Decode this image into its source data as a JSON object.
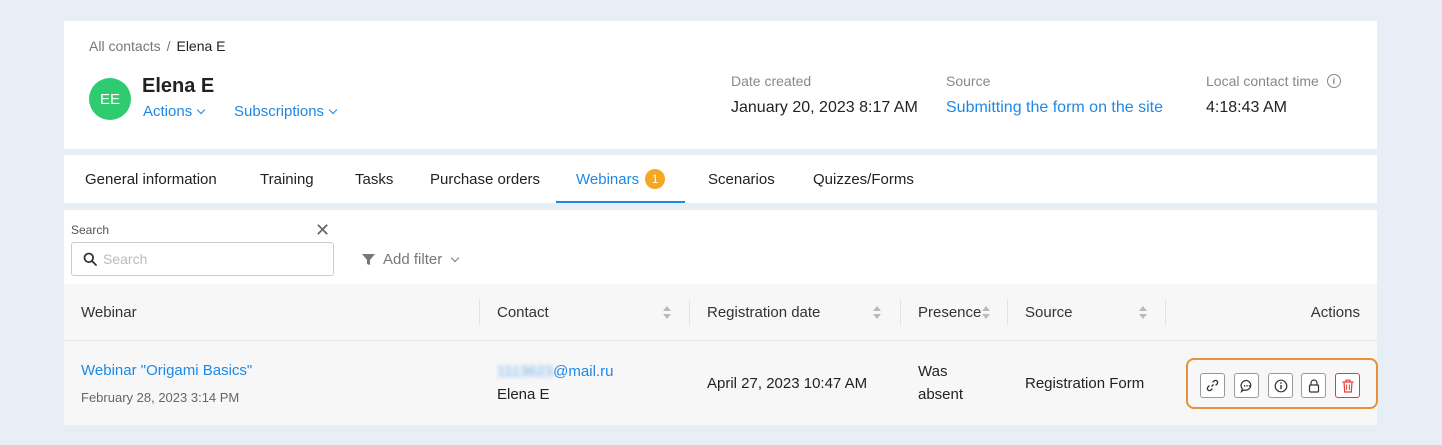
{
  "breadcrumb": {
    "root": "All contacts",
    "separator": "/",
    "current": "Elena E"
  },
  "contact": {
    "initials": "EE",
    "name": "Elena E",
    "actions_label": "Actions",
    "subscriptions_label": "Subscriptions",
    "avatar_color": "#2ecb71"
  },
  "meta": {
    "date_created_label": "Date created",
    "date_created_value": "January 20, 2023 8:17 AM",
    "source_label": "Source",
    "source_value": "Submitting the form on the site",
    "local_time_label": "Local contact time",
    "local_time_value": "4:18:43 AM"
  },
  "tabs": [
    {
      "label": "General information"
    },
    {
      "label": "Training"
    },
    {
      "label": "Tasks"
    },
    {
      "label": "Purchase orders"
    },
    {
      "label": "Webinars",
      "badge": "1",
      "active": true
    },
    {
      "label": "Scenarios"
    },
    {
      "label": "Quizzes/Forms"
    }
  ],
  "search": {
    "label": "Search",
    "placeholder": "Search",
    "value": ""
  },
  "filter": {
    "label": "Add filter"
  },
  "table": {
    "columns": [
      "Webinar",
      "Contact",
      "Registration date",
      "Presence",
      "Source",
      "Actions"
    ],
    "rows": [
      {
        "webinar": "Webinar \"Origami Basics\"",
        "webinar_date": "February 28, 2023 3:14 PM",
        "email_hidden": "1113623",
        "email_domain": "@mail.ru",
        "contact_name": "Elena E",
        "registration_date": "April 27, 2023 10:47 AM",
        "presence_line1": "Was",
        "presence_line2": "absent",
        "source": "Registration Form"
      }
    ]
  },
  "row_actions": [
    {
      "icon": "link-icon"
    },
    {
      "icon": "chat-icon"
    },
    {
      "icon": "info-icon"
    },
    {
      "icon": "lock-icon"
    },
    {
      "icon": "trash-icon"
    }
  ],
  "colors": {
    "accent": "#1e88e5",
    "badge": "#f5a623",
    "highlight": "#e8913a",
    "danger": "#e53935"
  }
}
